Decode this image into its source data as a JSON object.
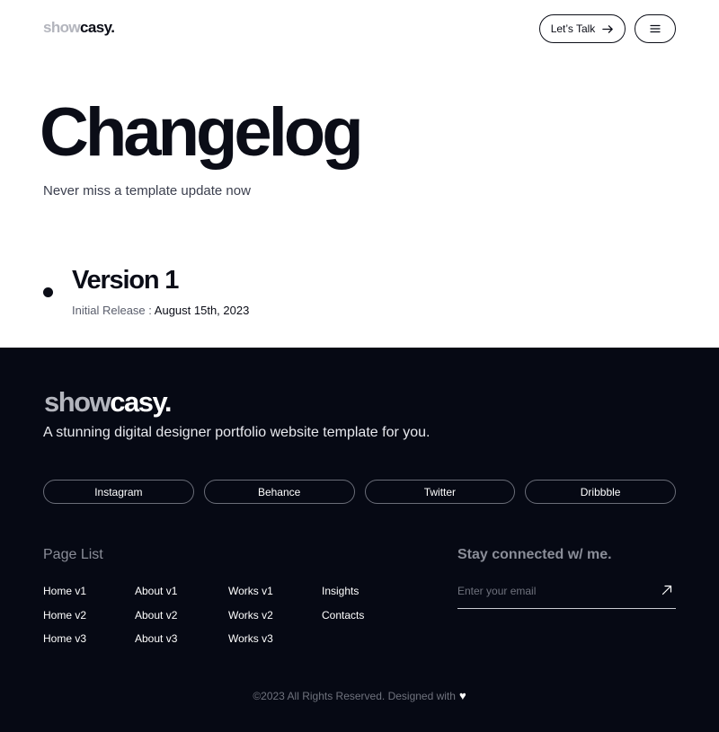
{
  "header": {
    "logo_show": "show",
    "logo_casy": "casy.",
    "talk_label": "Let’s Talk"
  },
  "hero": {
    "title": "Changelog",
    "subtitle": "Never miss a template update now"
  },
  "version": {
    "title": "Version 1",
    "meta_label": "Initial Release :",
    "date": "August 15th, 2023"
  },
  "footer": {
    "logo_show": "show",
    "logo_casy": "casy.",
    "tagline": "A stunning digital designer portfolio website template for you.",
    "social": [
      "Instagram",
      "Behance",
      "Twitter",
      "Dribbble"
    ],
    "page_list": {
      "title": "Page List",
      "links": [
        "Home v1",
        "Home v2",
        "Home v3",
        "About v1",
        "About v2",
        "About v3",
        "Works v1",
        "Works v2",
        "Works v3",
        "Insights",
        "Contacts"
      ]
    },
    "stay_connected": {
      "title": "Stay connected w/ me.",
      "placeholder": "Enter your email"
    },
    "copyright": "©2023 All Rights Reserved. Designed with"
  },
  "colors": {
    "ink": "#0b0d17",
    "footer_bg": "#060914",
    "logo_muted": "#b3b5bd"
  },
  "icons": [
    "arrow-right-icon",
    "hamburger-menu-icon",
    "arrow-up-right-icon",
    "heart-icon"
  ]
}
